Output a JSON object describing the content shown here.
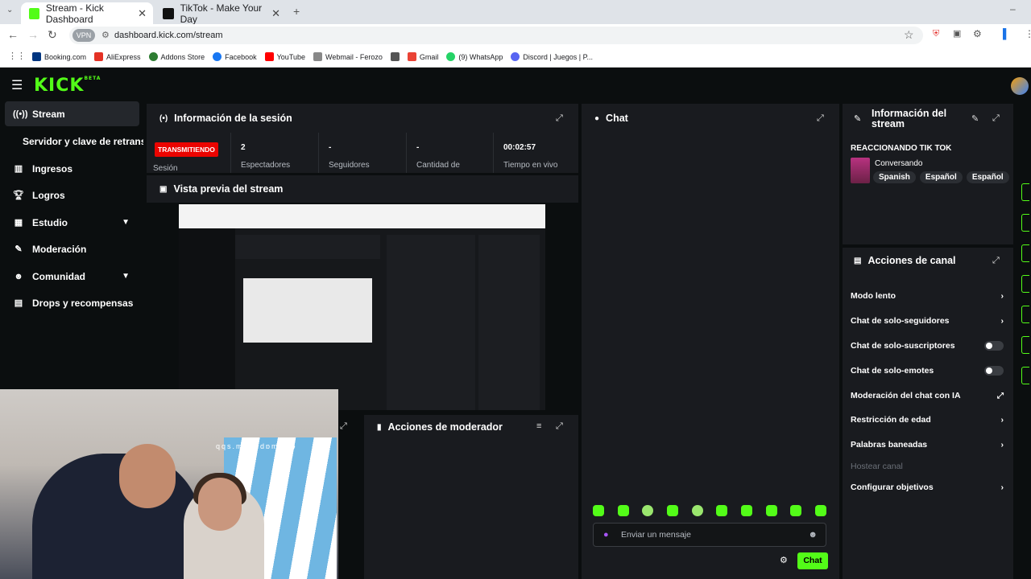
{
  "browser": {
    "tabs": [
      {
        "title": "Stream - Kick Dashboard",
        "active": true,
        "icon": "kick-icon"
      },
      {
        "title": "TikTok - Make Your Day",
        "active": false,
        "icon": "tiktok-icon"
      }
    ],
    "new_tab": "+",
    "vpn_label": "VPN",
    "url": "dashboard.kick.com/stream",
    "bookmarks": [
      {
        "label": "Booking.com",
        "color": "#003580"
      },
      {
        "label": "AliExpress",
        "color": "#e43225"
      },
      {
        "label": "Addons Store",
        "color": "#2e7d32"
      },
      {
        "label": "Facebook",
        "color": "#1877f2"
      },
      {
        "label": "YouTube",
        "color": "#ff0000"
      },
      {
        "label": "Webmail - Ferozo",
        "color": "#888888"
      },
      {
        "label": "",
        "color": "#555555"
      },
      {
        "label": "Gmail",
        "color": "#ea4335"
      },
      {
        "label": "(9) WhatsApp",
        "color": "#25d366"
      },
      {
        "label": "Discord | Juegos | P...",
        "color": "#5865f2"
      }
    ]
  },
  "app": {
    "logo": "KICK",
    "beta": "BETA",
    "accent": "#53fc18",
    "sidebar": [
      {
        "label": "Stream",
        "icon": "broadcast-icon",
        "active": true
      },
      {
        "label": "Servidor y clave de retransn",
        "icon": "",
        "sub": true
      },
      {
        "label": "Ingresos",
        "icon": "chart-icon"
      },
      {
        "label": "Logros",
        "icon": "trophy-icon"
      },
      {
        "label": "Estudio",
        "icon": "grid-icon",
        "chevron": true
      },
      {
        "label": "Moderación",
        "icon": "wrench-icon"
      },
      {
        "label": "Comunidad",
        "icon": "people-icon",
        "chevron": true
      },
      {
        "label": "Drops y recompensas",
        "icon": "gift-icon"
      }
    ],
    "session": {
      "title": "Información de la sesión",
      "live_badge": "TRANSMITIENDO",
      "session_label": "Sesión",
      "stats": [
        {
          "value": "2",
          "label": "Espectadores"
        },
        {
          "value": "-",
          "label": "Seguidores"
        },
        {
          "value": "-",
          "label": "Cantidad de"
        },
        {
          "value": "00:02:57",
          "label": "Tiempo en vivo"
        }
      ]
    },
    "preview": {
      "title": "Vista previa del stream"
    },
    "mod_actions": {
      "title": "Acciones de moderador"
    },
    "chat": {
      "title": "Chat",
      "placeholder": "Enviar un mensaje",
      "send_label": "Chat"
    },
    "stream_info": {
      "title": "Información del stream",
      "stream_title": "REACCIONANDO TIK TOK",
      "category": "Conversando",
      "tags": [
        "Spanish",
        "Español",
        "Español"
      ]
    },
    "channel_actions": {
      "title": "Acciones de canal",
      "items": [
        {
          "label": "Modo lento",
          "control": "chevron"
        },
        {
          "label": "Chat de solo-seguidores",
          "control": "chevron"
        },
        {
          "label": "Chat de solo-suscriptores",
          "control": "toggle"
        },
        {
          "label": "Chat de solo-emotes",
          "control": "toggle"
        },
        {
          "label": "Moderación del chat con IA",
          "control": "external"
        },
        {
          "label": "Restricción de edad",
          "control": "chevron"
        },
        {
          "label": "Palabras baneadas",
          "control": "chevron"
        },
        {
          "label": "Hostear canal",
          "control": "disabled"
        },
        {
          "label": "Configurar objetivos",
          "control": "chevron"
        }
      ]
    },
    "webcam_overlay_text": "qqs.mɘoɔdɒm.ɘiɔ"
  }
}
